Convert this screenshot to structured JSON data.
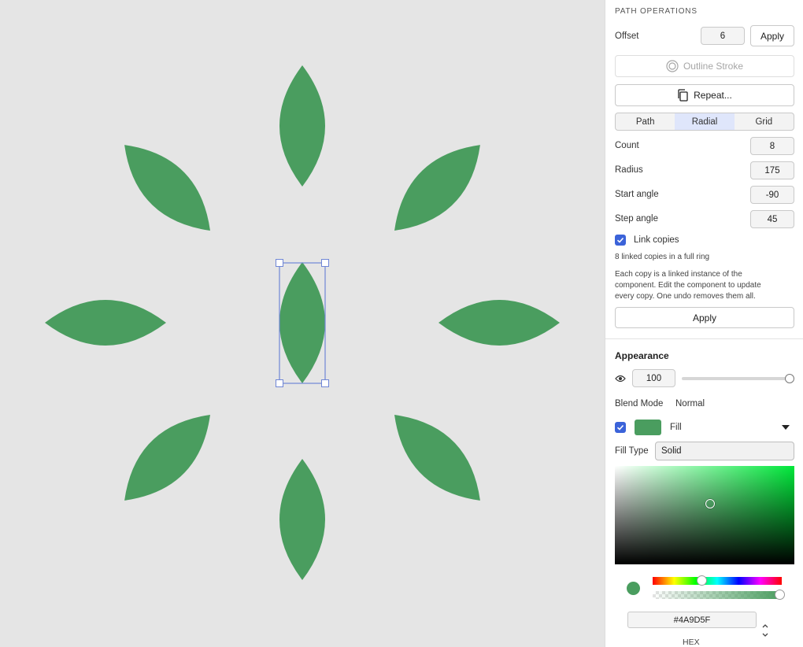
{
  "colors": {
    "leaf": "#4A9D5F",
    "accent": "#3b63d9",
    "selection": "#6f86d6",
    "canvas_bg": "#e5e5e5"
  },
  "canvas": {
    "leaf_count": 8,
    "selected_leaf": "center"
  },
  "path_ops": {
    "title": "PATH OPERATIONS",
    "offset_label": "Offset",
    "offset_value": "6",
    "offset_apply": "Apply",
    "outline_stroke": "Outline Stroke",
    "repeat": "Repeat...",
    "tabs": [
      "Path",
      "Radial",
      "Grid"
    ],
    "active_tab": "Radial",
    "fields": [
      {
        "label": "Count",
        "value": "8"
      },
      {
        "label": "Radius",
        "value": "175"
      },
      {
        "label": "Start angle",
        "value": "-90"
      },
      {
        "label": "Step angle",
        "value": "45"
      }
    ],
    "link_copies": "Link copies",
    "link_copies_checked": true,
    "summary": "8 linked copies in a full ring",
    "description": [
      "Each copy is a linked instance of the",
      "component. Edit the component to update",
      "every copy. One undo removes them all."
    ],
    "apply": "Apply"
  },
  "appearance": {
    "title": "Appearance",
    "opacity": "100",
    "blend_label": "Blend Mode",
    "blend_value": "Normal",
    "fill_label": "Fill",
    "fill_checked": true,
    "fill_type_label": "Fill Type",
    "fill_type_value": "Solid",
    "hex_value": "#4A9D5F",
    "hex_label": "HEX",
    "hue_fraction": 0.28,
    "alpha_fraction": 1.0
  },
  "icons": {
    "outline": "outline-stroke-icon",
    "repeat": "copy-icon",
    "eye": "eye-icon",
    "dropdown": "chevron-down-icon",
    "stepper": "stepper-icon"
  }
}
